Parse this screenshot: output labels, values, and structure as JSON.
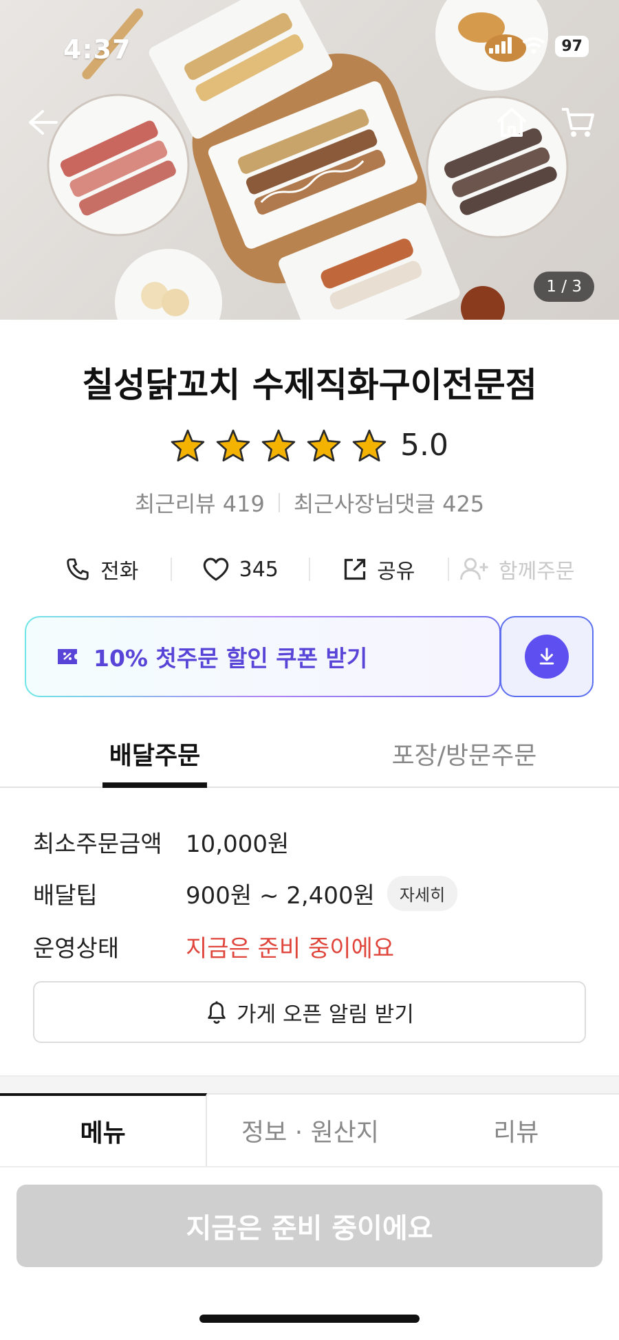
{
  "status_bar": {
    "time": "4:37",
    "battery": "97"
  },
  "hero": {
    "page_indicator": "1 / 3"
  },
  "store": {
    "name": "칠성닭꼬치 수제직화구이전문점",
    "rating": 5.0,
    "rating_text": "5.0",
    "recent_reviews": "최근리뷰 419",
    "owner_replies": "최근사장님댓글 425"
  },
  "actions": [
    {
      "label": "전화",
      "icon": "phone-icon"
    },
    {
      "label": "345",
      "icon": "heart-icon"
    },
    {
      "label": "공유",
      "icon": "share-icon"
    },
    {
      "label": "함께주문",
      "icon": "add-person-icon"
    }
  ],
  "coupon": {
    "label": "10% 첫주문 할인 쿠폰 받기",
    "icon": "coupon-icon",
    "download_icon": "download-icon"
  },
  "order_tabs": [
    {
      "label": "배달주문",
      "active": true
    },
    {
      "label": "포장/방문주문",
      "active": false
    }
  ],
  "delivery_info": {
    "min_order_label": "최소주문금액",
    "min_order_value": "10,000원",
    "tip_label": "배달팁",
    "tip_value": "900원 ~ 2,400원",
    "tip_detail": "자세히",
    "status_label": "운영상태",
    "status_value": "지금은 준비 중이에요"
  },
  "notify_button": {
    "label": "가게 오픈 알림 받기",
    "icon": "bell-icon"
  },
  "menu_tabs": [
    {
      "label": "메뉴",
      "active": true
    },
    {
      "label": "정보 · 원산지",
      "active": false
    },
    {
      "label": "리뷰",
      "active": false
    }
  ],
  "cta": {
    "label": "지금은 준비 중이에요"
  },
  "colors": {
    "accent": "#5845d8",
    "status_red": "#e0453c",
    "star": "#f5b301"
  }
}
